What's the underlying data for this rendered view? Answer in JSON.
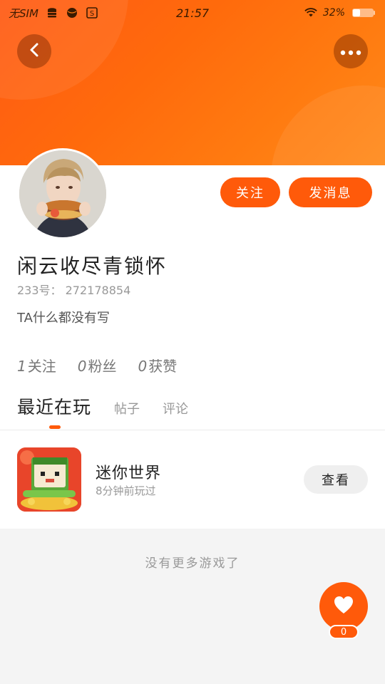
{
  "status_bar": {
    "carrier": "无SIM",
    "time": "21:57",
    "battery": "32%"
  },
  "header": {
    "back_icon": "chevron-left-icon",
    "more_icon": "more-horizontal-icon"
  },
  "profile": {
    "nickname": "闲云收尽青锁怀",
    "uid": "233号： 272178854",
    "bio": "TA什么都没有写",
    "follow_label": "关注",
    "message_label": "发消息"
  },
  "stats": [
    {
      "num": "1",
      "label": "关注"
    },
    {
      "num": "0",
      "label": "粉丝"
    },
    {
      "num": "0",
      "label": "获赞"
    }
  ],
  "tabs": [
    {
      "label": "最近在玩",
      "active": true
    },
    {
      "label": "帖子",
      "active": false
    },
    {
      "label": "评论",
      "active": false
    }
  ],
  "game": {
    "name": "迷你世界",
    "last_played": "8分钟前玩过",
    "view_label": "查看"
  },
  "footer": {
    "no_more_text": "没有更多游戏了"
  },
  "like": {
    "icon": "heart-icon",
    "count": "0"
  },
  "colors": {
    "accent": "#ff5a0a",
    "header_gradient_start": "#ff5a14",
    "header_gradient_end": "#ff8a1a"
  }
}
